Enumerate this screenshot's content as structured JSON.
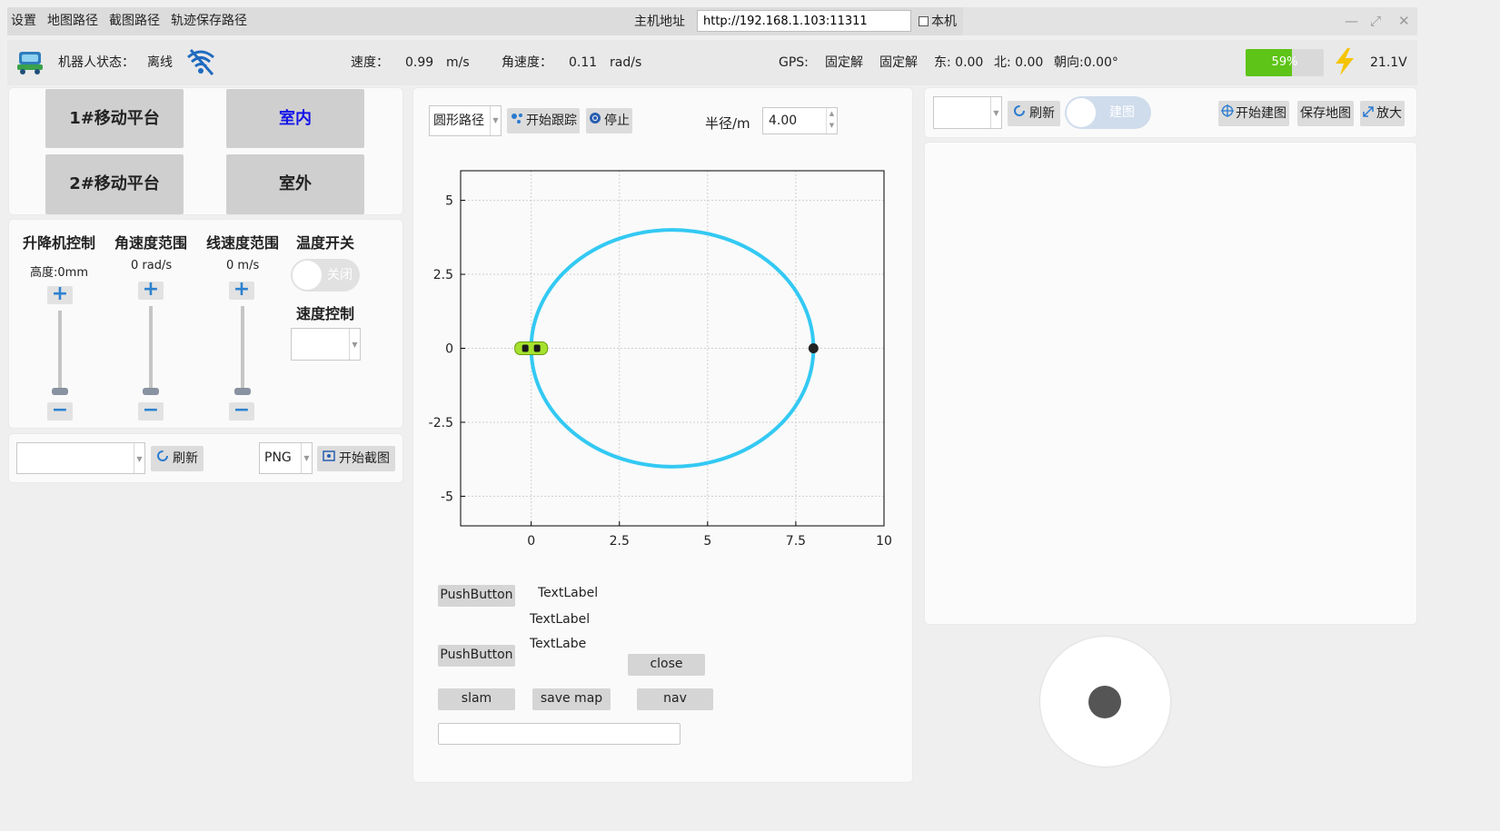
{
  "menu": {
    "items": [
      "设置",
      "地图路径",
      "截图路径",
      "轨迹保存路径"
    ],
    "host_label": "主机地址",
    "host_value": "http://192.168.1.103:11311",
    "local_label": "本机"
  },
  "status": {
    "robot_state_label": "机器人状态：",
    "robot_state_value": "离线",
    "speed_label": "速度：",
    "speed_value": "0.99",
    "speed_unit": "m/s",
    "angular_label": "角速度：",
    "angular_value": "0.11",
    "angular_unit": "rad/s",
    "gps_label": "GPS:",
    "gps_fix1": "固定解",
    "gps_fix2": "固定解",
    "east": "东: 0.00",
    "north": "北: 0.00",
    "heading": "朝向:0.00°",
    "battery_percent": 59,
    "battery_text": "59%",
    "voltage": "21.1V",
    "colors": {
      "battery": "#5ec417",
      "bolt": "#f5c400",
      "wifi": "#1f6bbf"
    }
  },
  "platform": {
    "btn1": "1#移动平台",
    "btn2": "2#移动平台",
    "indoor": "室内",
    "outdoor": "室外",
    "indoor_color": "#1515e8"
  },
  "controls": {
    "lift_title": "升降机控制",
    "lift_value": "高度:0mm",
    "angular_title": "角速度范围",
    "angular_value": "0 rad/s",
    "linear_title": "线速度范围",
    "linear_value": "0 m/s",
    "temp_title": "温度开关",
    "temp_toggle": "关闭",
    "speed_ctrl_title": "速度控制",
    "plus": "+",
    "minus": "−"
  },
  "capture": {
    "refresh": "刷新",
    "format": "PNG",
    "start": "开始截图"
  },
  "path": {
    "type": "圆形路径",
    "start_track": "开始跟踪",
    "stop": "停止",
    "radius_label": "半径/m",
    "radius_value": "4.00"
  },
  "chart_data": {
    "type": "line",
    "title": "",
    "xlabel": "",
    "ylabel": "",
    "xlim": [
      -2,
      10
    ],
    "ylim": [
      -6,
      6
    ],
    "xticks": [
      0,
      2.5,
      5,
      7.5,
      10
    ],
    "xtick_labels": [
      "0",
      "2.5",
      "5",
      "7.5",
      "10"
    ],
    "yticks": [
      5,
      2.5,
      0,
      -2.5,
      -5
    ],
    "ytick_labels": [
      "5",
      "2.5",
      "0",
      "-2.5",
      "-5"
    ],
    "grid": true,
    "series": [
      {
        "kind": "circle",
        "center": [
          4,
          0
        ],
        "radius": 4,
        "color": "#33c9f3"
      }
    ],
    "markers": [
      {
        "name": "target-point",
        "x": 8,
        "y": 0,
        "color": "#222222"
      },
      {
        "name": "vehicle",
        "x": 0,
        "y": 0,
        "color": "#a6e22e"
      }
    ]
  },
  "bottom_mid": {
    "push1": "PushButton",
    "push2": "PushButton",
    "label1": "TextLabel",
    "label2": "TextLabel",
    "label3": "TextLabe",
    "close": "close",
    "slam": "slam",
    "save_map": "save map",
    "nav": "nav"
  },
  "map": {
    "refresh": "刷新",
    "build_toggle": "建图",
    "start_build": "开始建图",
    "save_map": "保存地图",
    "zoom": "放大"
  }
}
